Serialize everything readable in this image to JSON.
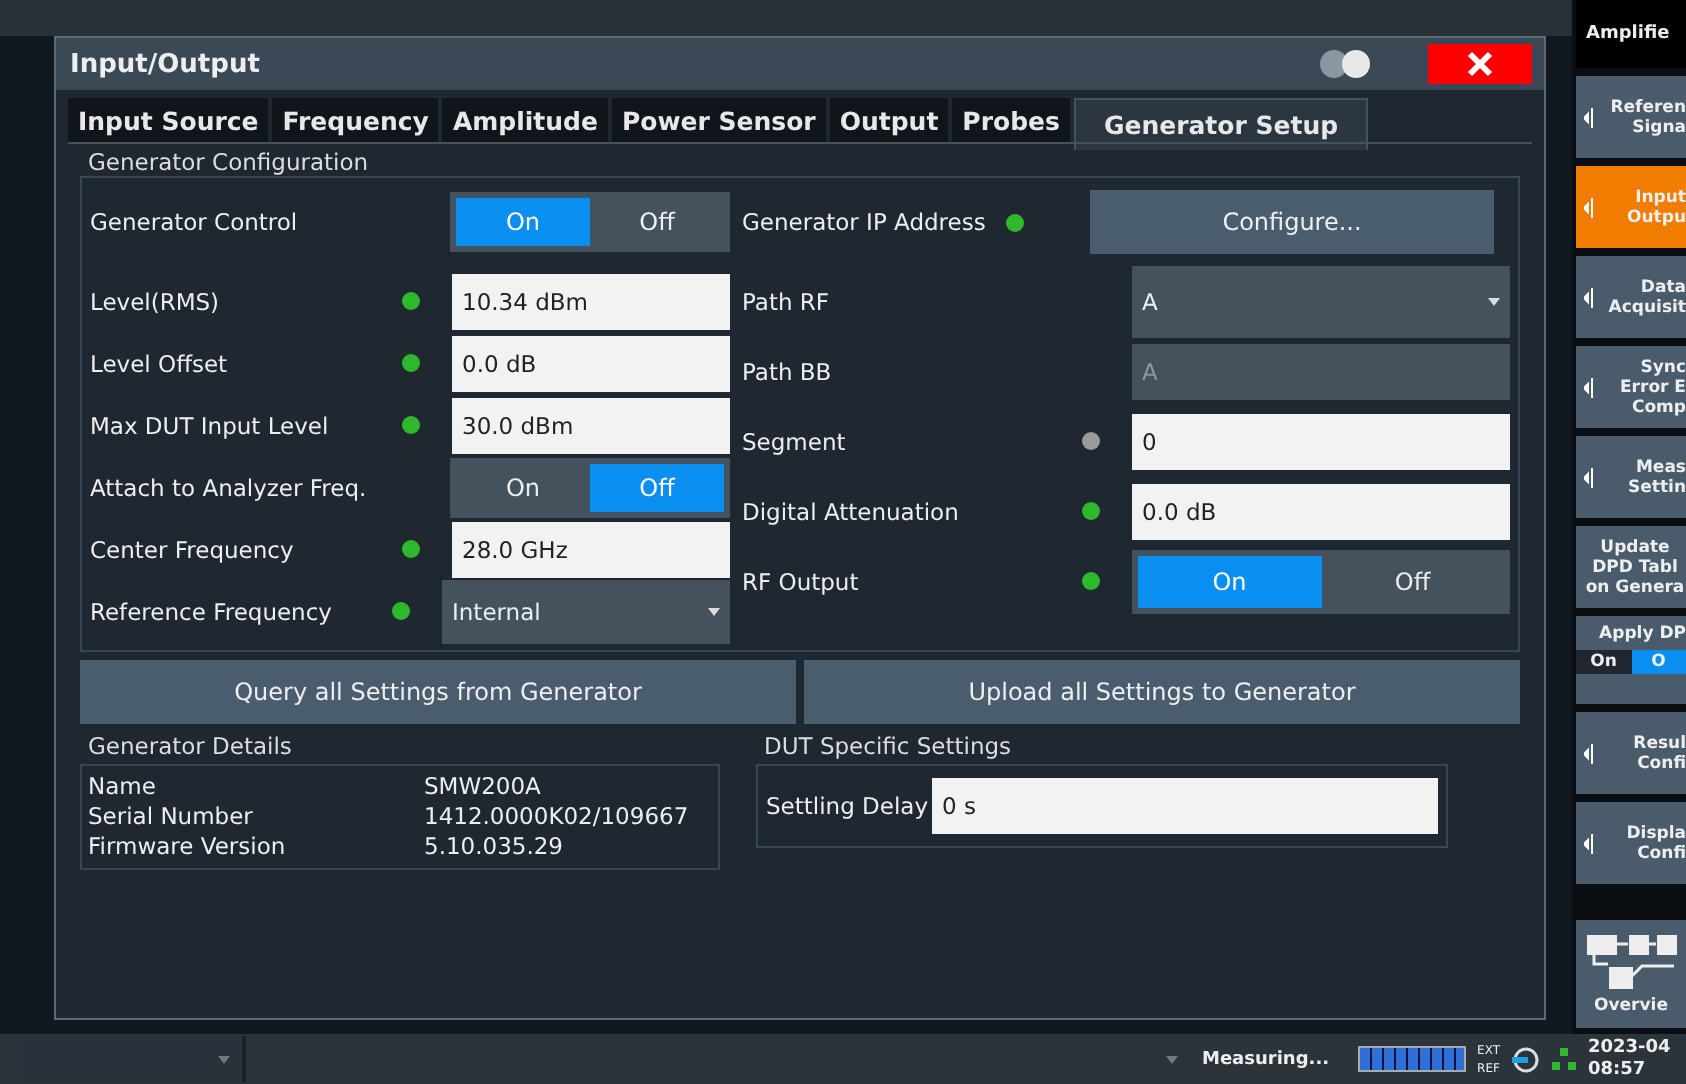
{
  "dialog": {
    "title": "Input/Output",
    "tabs": [
      {
        "label": "Input Source",
        "selected": false
      },
      {
        "label": "Frequency",
        "selected": false
      },
      {
        "label": "Amplitude",
        "selected": false
      },
      {
        "label": "Power Sensor",
        "selected": false
      },
      {
        "label": "Output",
        "selected": false
      },
      {
        "label": "Probes",
        "selected": false
      },
      {
        "label": "Generator Setup",
        "selected": true
      }
    ],
    "generator_configuration": {
      "title": "Generator Configuration",
      "generator_control": {
        "label": "Generator Control",
        "options": [
          {
            "label": "On",
            "selected": true
          },
          {
            "label": "Off",
            "selected": false
          }
        ]
      },
      "generator_ip": {
        "label": "Generator IP Address",
        "color": "#2eb82e",
        "button": "Configure..."
      },
      "left_rows": [
        {
          "kind": "input",
          "label": "Level(RMS)",
          "color": "#2eb82e",
          "value": "10.34 dBm"
        },
        {
          "kind": "input",
          "label": "Level Offset",
          "color": "#2eb82e",
          "value": "0.0 dB"
        },
        {
          "kind": "input",
          "label": "Max DUT Input Level",
          "color": "#2eb82e",
          "value": "30.0 dBm"
        },
        {
          "kind": "toggle",
          "label": "Attach to Analyzer Freq.",
          "options": [
            {
              "label": "On",
              "selected": false
            },
            {
              "label": "Off",
              "selected": true
            }
          ]
        },
        {
          "kind": "input",
          "label": "Center Frequency",
          "color": "#2eb82e",
          "value": "28.0 GHz"
        },
        {
          "kind": "dropdown",
          "label": "Reference Frequency",
          "color": "#2eb82e",
          "value": "Internal"
        }
      ],
      "right_rows": [
        {
          "kind": "dropdown",
          "label": "Path RF",
          "value": "A",
          "disabled": false
        },
        {
          "kind": "input",
          "label": "Path BB",
          "value": "A",
          "disabled": true
        },
        {
          "kind": "input",
          "label": "Segment",
          "color": "#9a9a9a",
          "value": "0",
          "disabled": false
        },
        {
          "kind": "input",
          "label": "Digital Attenuation",
          "color": "#2eb82e",
          "value": "0.0 dB",
          "disabled": false
        },
        {
          "kind": "toggle",
          "label": "RF Output",
          "color": "#2eb82e",
          "options": [
            {
              "label": "On",
              "selected": true
            },
            {
              "label": "Off",
              "selected": false
            }
          ]
        }
      ],
      "buttons": [
        "Query all Settings from Generator",
        "Upload all Settings to Generator"
      ]
    },
    "generator_details": {
      "title": "Generator Details",
      "rows": [
        {
          "label": "Name",
          "value": "SMW200A"
        },
        {
          "label": "Serial Number",
          "value": "1412.0000K02/109667"
        },
        {
          "label": "Firmware Version",
          "value": "5.10.035.29"
        }
      ]
    },
    "dut_settings": {
      "title": "DUT Specific Settings",
      "label": "Settling Delay",
      "value": "0 s"
    }
  },
  "sidebar": {
    "header": "Amplifie",
    "items": [
      {
        "kind": "button",
        "lines": [
          "Referen",
          "Signa"
        ],
        "selected": false
      },
      {
        "kind": "button",
        "lines": [
          "Input",
          "Outpu"
        ],
        "selected": true
      },
      {
        "kind": "button",
        "lines": [
          "Data",
          "Acquisit"
        ],
        "selected": false
      },
      {
        "kind": "button",
        "lines": [
          "Sync",
          "Error E",
          "Comp"
        ],
        "selected": false
      },
      {
        "kind": "button",
        "lines": [
          "Meas",
          "Settin"
        ],
        "selected": false
      },
      {
        "kind": "plain",
        "lines": [
          "Update",
          "DPD Tabl",
          "on Genera"
        ],
        "selected": false
      },
      {
        "kind": "toggle",
        "lines": [
          "Apply DP"
        ],
        "options": [
          {
            "label": "On",
            "selected": false
          },
          {
            "label": "O",
            "selected": true
          }
        ]
      },
      {
        "kind": "button",
        "lines": [
          "Resul",
          "Confi"
        ],
        "selected": false
      },
      {
        "kind": "button",
        "lines": [
          "Displa",
          "Confi"
        ],
        "selected": false
      },
      {
        "kind": "overview",
        "lines": [
          "Overvie"
        ],
        "selected": false
      }
    ]
  },
  "status_bar": {
    "status": "Measuring...",
    "progress": {
      "level": 1
    },
    "ref": [
      "EXT",
      "REF"
    ],
    "date": "2023-04",
    "time": "08:57"
  }
}
